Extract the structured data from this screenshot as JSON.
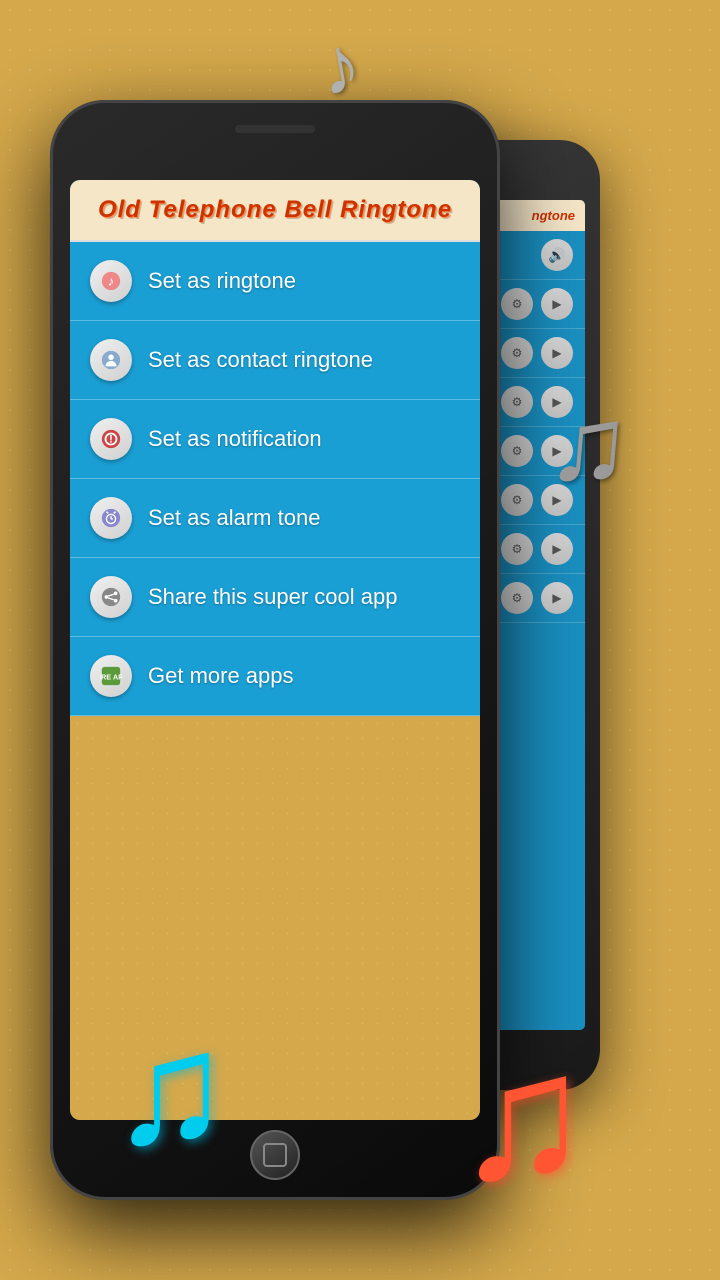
{
  "app": {
    "title": "Old Telephone Bell Ringtone"
  },
  "menu": {
    "items": [
      {
        "id": "ringtone",
        "label": "Set as ringtone",
        "icon": "🎵"
      },
      {
        "id": "contact-ringtone",
        "label": "Set as contact ringtone",
        "icon": "👤"
      },
      {
        "id": "notification",
        "label": "Set as notification",
        "icon": "🔔"
      },
      {
        "id": "alarm",
        "label": "Set as alarm tone",
        "icon": "⏰"
      },
      {
        "id": "share",
        "label": "Share this super cool app",
        "icon": "↗"
      },
      {
        "id": "more-apps",
        "label": "Get more apps",
        "icon": "📱"
      }
    ]
  },
  "back_phone": {
    "header_title": "ngtone",
    "rows": [
      {
        "icon": "🔊"
      },
      {
        "icon": "⚙"
      },
      {
        "icon": "⚙"
      },
      {
        "icon": "⚙"
      },
      {
        "icon": "⚙"
      },
      {
        "icon": "⚙"
      },
      {
        "icon": "⚙"
      }
    ]
  },
  "notes": {
    "silver_top": "♪",
    "silver_mid": "♫",
    "cyan": "♫",
    "red": "♫"
  }
}
